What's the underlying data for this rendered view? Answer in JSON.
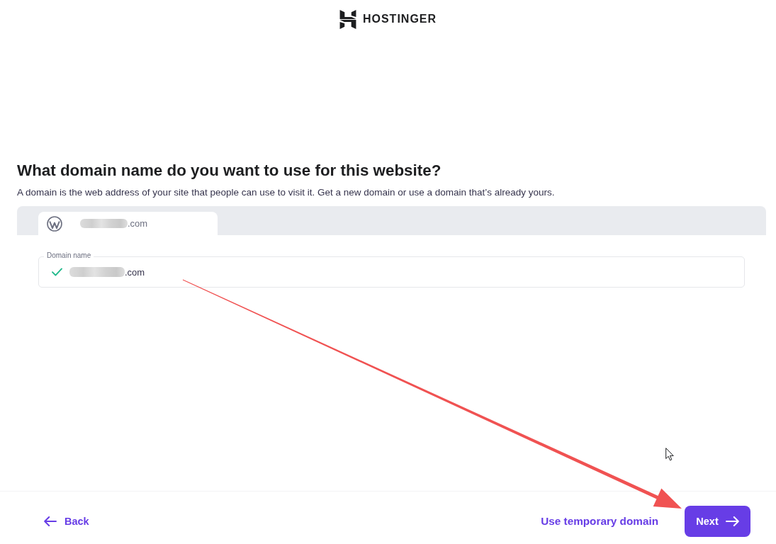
{
  "header": {
    "logo_text": "HOSTINGER"
  },
  "title": "What domain name do you want to use for this website?",
  "description": "A domain is the web address of your site that people can use to visit it. Get a new domain or use a domain that’s already yours.",
  "site_tabs": [
    {
      "label": ".com",
      "redacted": true,
      "selected": true
    }
  ],
  "domain_field": {
    "label": "Domain name",
    "value": ".com",
    "redacted": true,
    "valid": true
  },
  "footer": {
    "back": "Back",
    "secondary": "Use temporary domain",
    "primary": "Next"
  }
}
